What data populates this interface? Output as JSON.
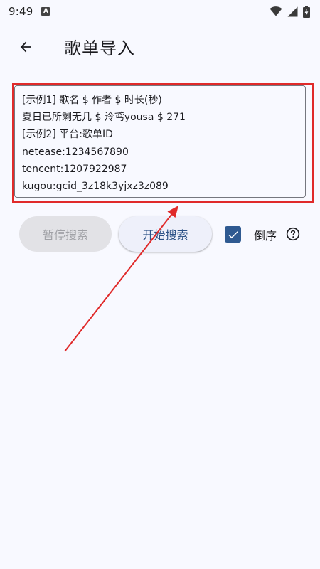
{
  "status_bar": {
    "time": "9:49",
    "app_icon_letter": "A",
    "icons": [
      "wifi-icon",
      "signal-icon",
      "battery-icon"
    ]
  },
  "app_bar": {
    "back_icon": "arrow-left-icon",
    "title": "歌单导入"
  },
  "input": {
    "lines": [
      "[示例1] 歌名 $ 作者 $ 时长(秒)",
      "夏日已所剩无几 $ 泠鸢yousa $ 271",
      "[示例2] 平台:歌单ID",
      "netease:1234567890",
      "tencent:1207922987",
      "kugou:gcid_3z18k3yjxz3z089"
    ]
  },
  "actions": {
    "pause_label": "暂停搜索",
    "start_label": "开始搜索",
    "reverse_label": "倒序",
    "reverse_checked": true,
    "help_icon": "help-circle-icon"
  },
  "colors": {
    "background": "#f8f9ff",
    "primary": "#2f5a91",
    "annotation": "#e02a2a"
  }
}
